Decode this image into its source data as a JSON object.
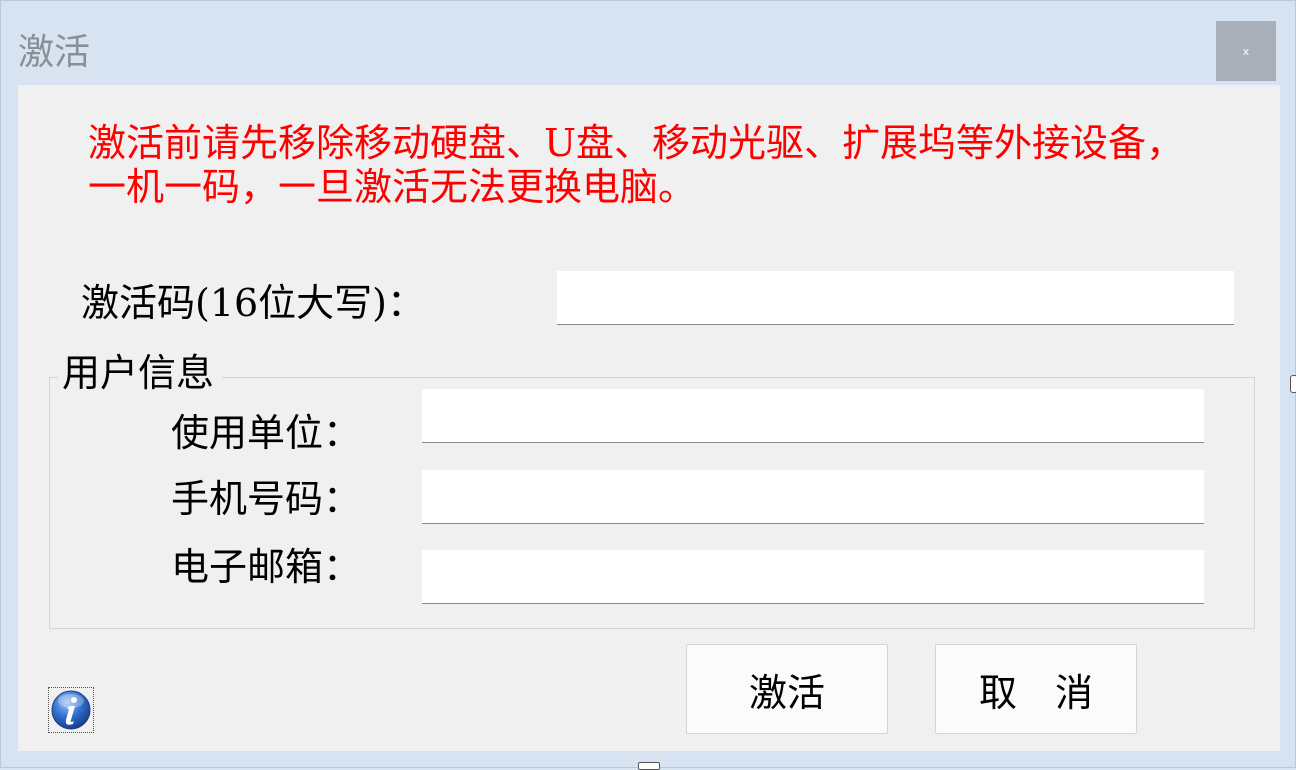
{
  "window": {
    "title": "激活",
    "close_label": "x"
  },
  "notice": "激活前请先移除移动硬盘、U盘、移动光驱、扩展坞等外接设备，一机一码，一旦激活无法更换电脑。",
  "activation_code": {
    "label": "激活码(16位大写)：",
    "value": ""
  },
  "user_info": {
    "legend": "用户信息",
    "fields": [
      {
        "label": "使用单位：",
        "value": ""
      },
      {
        "label": "手机号码：",
        "value": ""
      },
      {
        "label": "电子邮箱：",
        "value": ""
      }
    ]
  },
  "buttons": {
    "activate_label": "激活",
    "cancel_label": "取　消"
  },
  "icons": {
    "info": "info-icon"
  },
  "colors": {
    "notice": "#ff0000",
    "title_bar": "#d7e3f1",
    "content_bg": "#f0f0f0",
    "close_button": "#a8afb8"
  }
}
